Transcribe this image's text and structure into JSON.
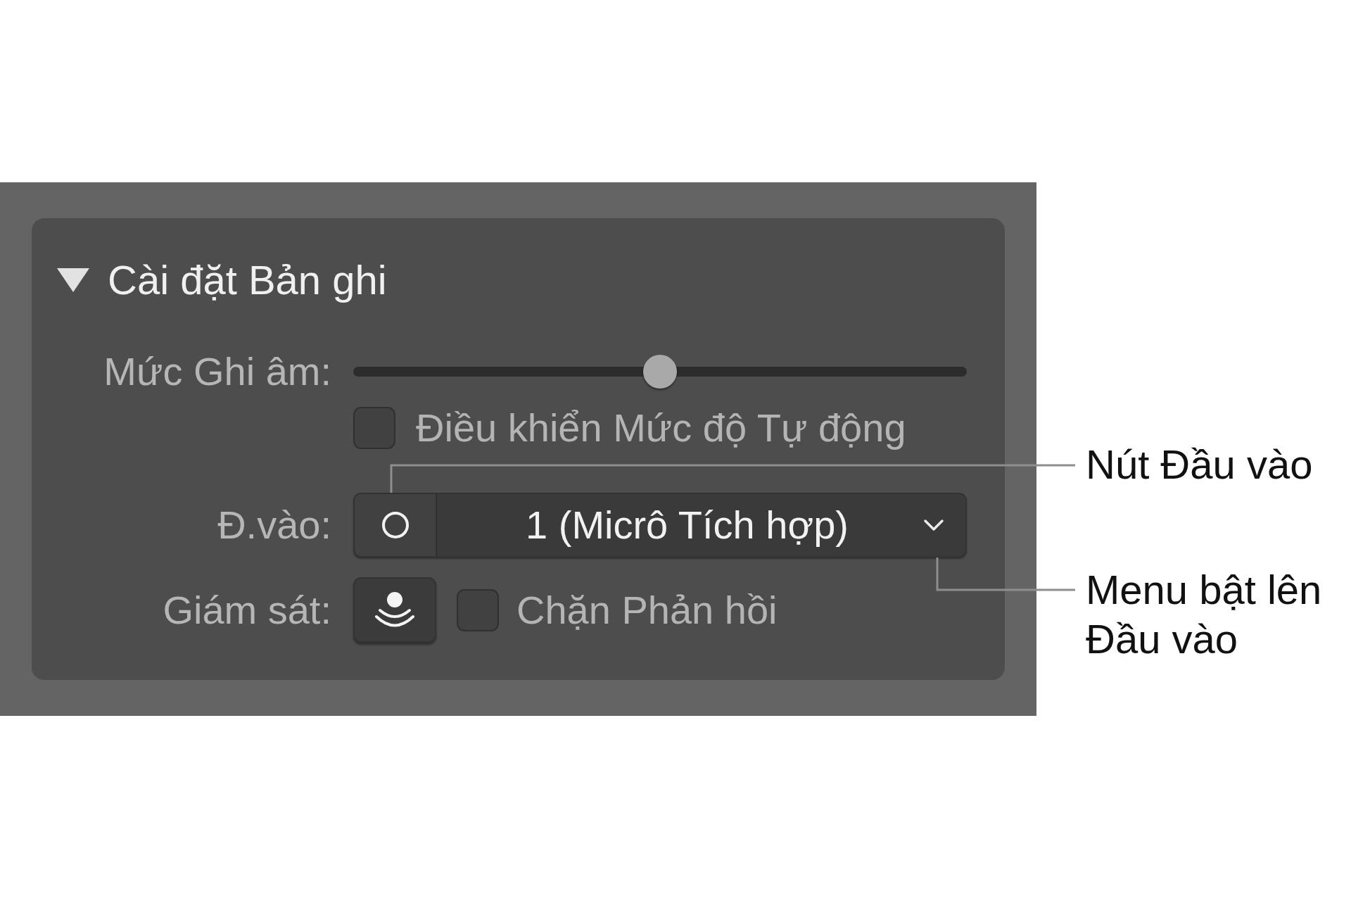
{
  "recording_settings": {
    "title": "Cài đặt Bản ghi",
    "expanded": true,
    "recording_level": {
      "label": "Mức Ghi âm:",
      "level": 0.5
    },
    "automatic_level_control": {
      "label": "Điều khiển Mức độ Tự động",
      "checked": false
    },
    "input": {
      "label": "Đ.vào:",
      "value": "1 (Micrô Tích hợp)"
    },
    "monitoring": {
      "label": "Giám sát:"
    },
    "feedback_protection": {
      "label": "Chặn Phản hồi",
      "checked": false
    }
  },
  "callouts": [
    {
      "text": "Nút Đầu vào"
    },
    {
      "text": "Menu bật lên Đầu vào"
    }
  ]
}
